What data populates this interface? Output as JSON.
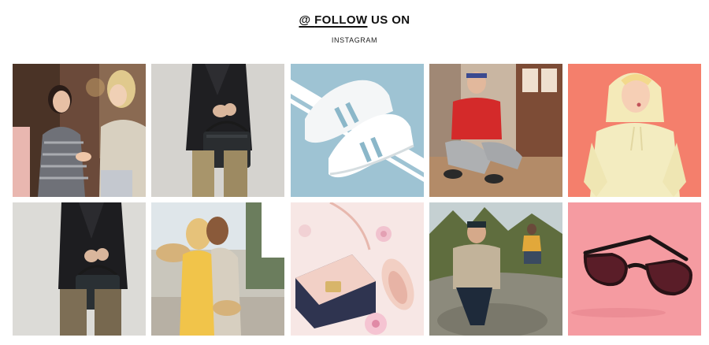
{
  "header": {
    "at_symbol": "@",
    "follow_link": "FOLLOW",
    "title_rest": "US ON",
    "subtitle": "INSTAGRAM"
  },
  "colors": {
    "background": "#ffffff",
    "text": "#111111"
  },
  "tiles": [
    {
      "name": "two-women-shopping"
    },
    {
      "name": "woman-holding-black-handbag"
    },
    {
      "name": "white-sneakers-blue-background"
    },
    {
      "name": "man-red-shirt-sitting-floor"
    },
    {
      "name": "woman-yellow-hoodie-coral-background"
    },
    {
      "name": "woman-coat-black-handbag"
    },
    {
      "name": "two-women-yellow-dress-hat"
    },
    {
      "name": "pink-purse-and-flats"
    },
    {
      "name": "men-sitting-on-rocks"
    },
    {
      "name": "dark-cat-eye-sunglasses-pink-background"
    }
  ]
}
